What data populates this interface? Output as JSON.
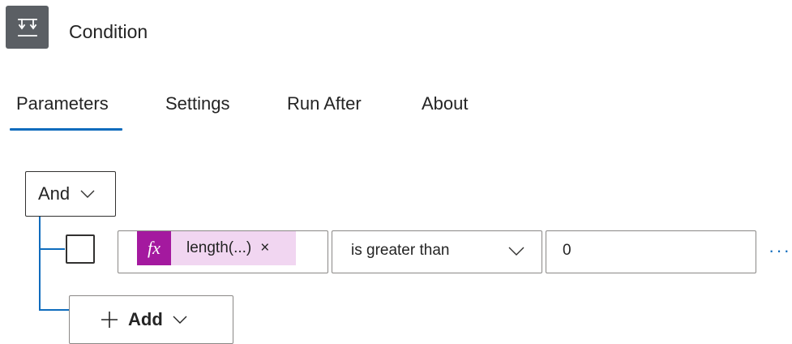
{
  "header": {
    "title": "Condition",
    "icon": "condition-icon",
    "icon_bg": "#5b5f64"
  },
  "tabs": [
    {
      "label": "Parameters",
      "selected": true
    },
    {
      "label": "Settings",
      "selected": false
    },
    {
      "label": "Run After",
      "selected": false
    },
    {
      "label": "About",
      "selected": false
    }
  ],
  "accent_color": "#0f6cbd",
  "group": {
    "operator": "And",
    "rows": [
      {
        "checked": false,
        "left_operand": {
          "token_icon": "fx",
          "token_label": "length(...)",
          "remove_glyph": "×",
          "token_color": "#a4199f",
          "token_bg": "#f1d6f1"
        },
        "comparison": "is greater than",
        "right_operand": "0",
        "more_glyph": "···"
      }
    ],
    "add_label": "Add",
    "add_glyph": "+"
  }
}
